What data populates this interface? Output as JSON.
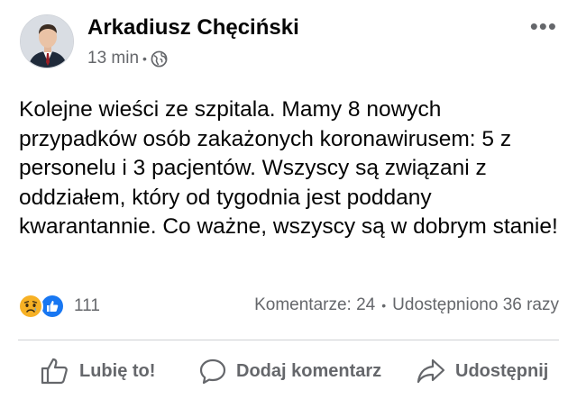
{
  "post": {
    "author": "Arkadiusz Chęciński",
    "time": "13 min",
    "privacy_icon": "globe-icon",
    "more_label": "•••",
    "text": "Kolejne wieści ze szpitala. Mamy 8 nowych przypadków osób zakażonych koronawirusem: 5 z personelu i 3 pacjentów. Wszyscy są związani z oddziałem, który od tygodnia jest poddany kwarantannie. Co ważne, wszyscy są w dobrym stanie!"
  },
  "reactions": {
    "icons": [
      "sad-reaction-icon",
      "like-reaction-icon"
    ],
    "count": "111",
    "comments": "Komentarze: 24",
    "shares": "Udostępniono 36 razy"
  },
  "actions": {
    "like": "Lubię to!",
    "comment": "Dodaj komentarz",
    "share": "Udostępnij"
  },
  "colors": {
    "text": "#050505",
    "secondary": "#65676b",
    "like_blue": "#1877f2",
    "sad_yellow": "#f7b125",
    "divider": "#ced0d4"
  }
}
